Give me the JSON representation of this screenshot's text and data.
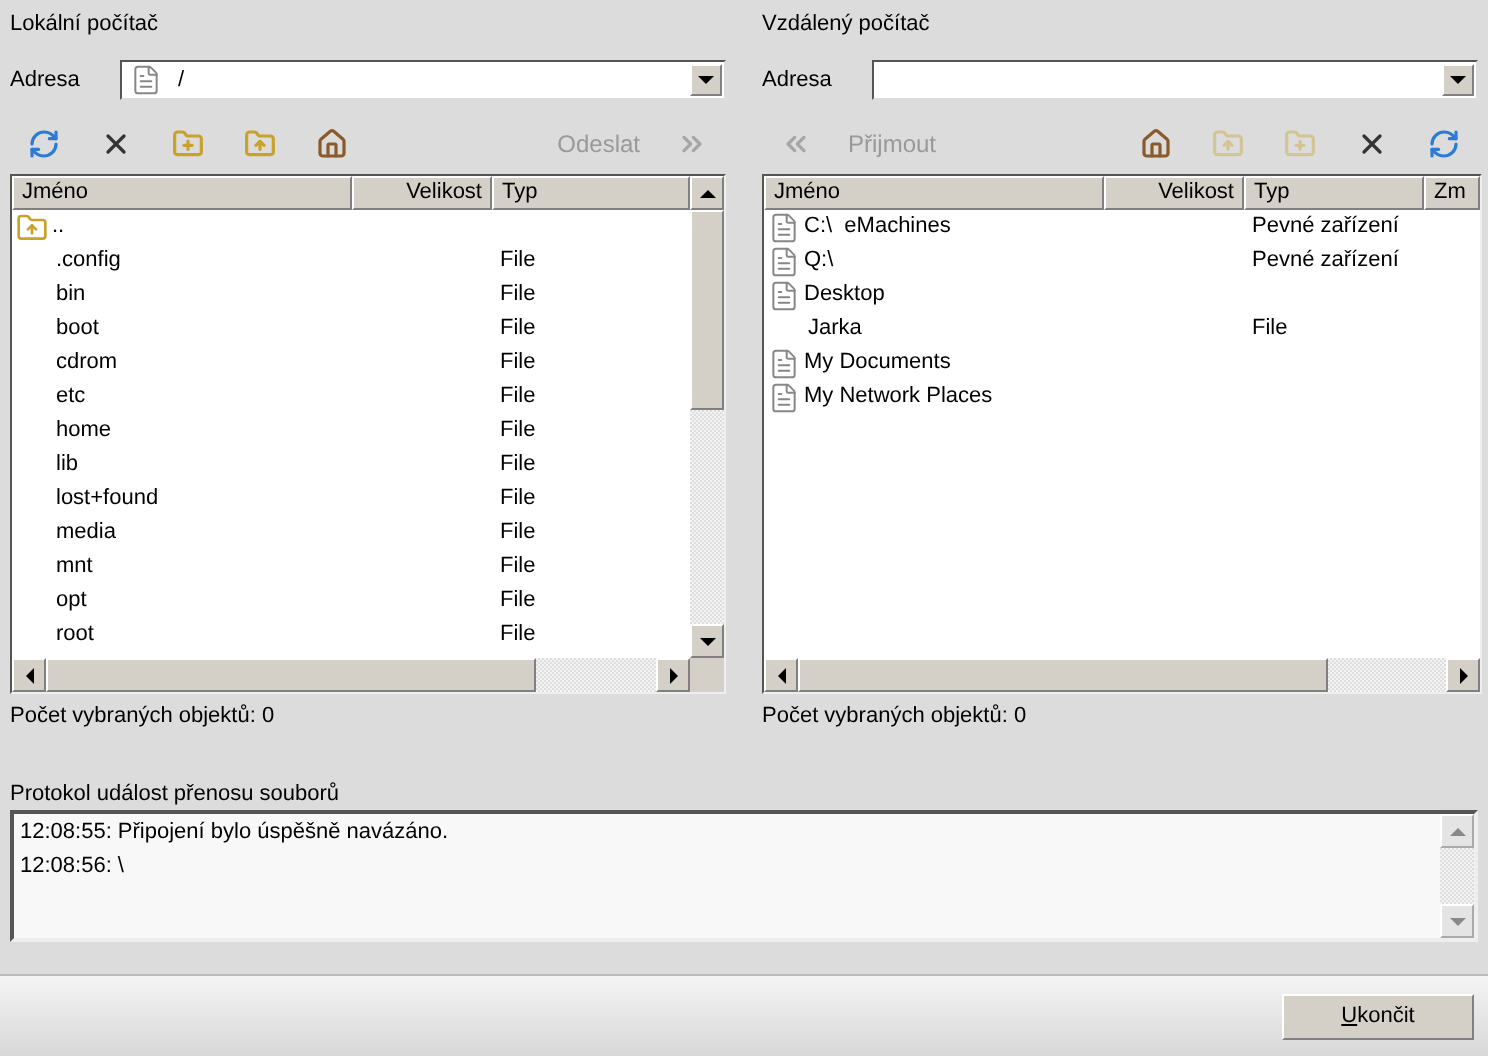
{
  "local": {
    "title": "Lokální počítač",
    "address_label": "Adresa",
    "address": "/",
    "toolbar": [
      {
        "kind": "refresh",
        "disabled": false
      },
      {
        "kind": "delete",
        "disabled": false
      },
      {
        "kind": "new_folder",
        "disabled": false
      },
      {
        "kind": "folder_up",
        "disabled": false
      },
      {
        "kind": "home",
        "disabled": false
      },
      {
        "kind": "spacer"
      },
      {
        "kind": "label",
        "text": "Odeslat",
        "disabled": true
      },
      {
        "kind": "send",
        "disabled": true
      }
    ],
    "columns": [
      "Jméno",
      "Velikost",
      "Typ"
    ],
    "rows": [
      {
        "kind": "folder_up",
        "name": "..",
        "type": ""
      },
      {
        "name": ".config",
        "type": "File"
      },
      {
        "name": "bin",
        "type": "File"
      },
      {
        "name": "boot",
        "type": "File"
      },
      {
        "name": "cdrom",
        "type": "File"
      },
      {
        "name": "etc",
        "type": "File"
      },
      {
        "name": "home",
        "type": "File"
      },
      {
        "name": "lib",
        "type": "File"
      },
      {
        "name": "lost+found",
        "type": "File"
      },
      {
        "name": "media",
        "type": "File"
      },
      {
        "name": "mnt",
        "type": "File"
      },
      {
        "name": "opt",
        "type": "File"
      },
      {
        "name": "root",
        "type": "File"
      }
    ],
    "status": "Počet vybraných objektů: 0"
  },
  "remote": {
    "title": "Vzdálený počítač",
    "address_label": "Adresa",
    "toolbar": [
      {
        "kind": "receive",
        "disabled": true
      },
      {
        "kind": "label",
        "text": "Přijmout",
        "disabled": true
      },
      {
        "kind": "spacer"
      },
      {
        "kind": "home",
        "disabled": false
      },
      {
        "kind": "folder_up",
        "disabled": true
      },
      {
        "kind": "new_folder",
        "disabled": true
      },
      {
        "kind": "delete",
        "disabled": false
      },
      {
        "kind": "refresh",
        "disabled": false
      }
    ],
    "columns": [
      "Jméno",
      "Velikost",
      "Typ",
      "Zm"
    ],
    "rows": [
      {
        "kind": "document",
        "name": "C:\\  eMachines",
        "type": "Pevné zařízení"
      },
      {
        "kind": "document",
        "name": "Q:\\",
        "type": "Pevné zařízení"
      },
      {
        "kind": "document",
        "name": "Desktop",
        "type": ""
      },
      {
        "name": "Jarka",
        "type": "File"
      },
      {
        "kind": "document",
        "name": "My Documents",
        "type": ""
      },
      {
        "kind": "document",
        "name": "My Network Places",
        "type": ""
      }
    ],
    "status": "Počet vybraných objektů: 0"
  },
  "log": {
    "title": "Protokol událost přenosu souborů",
    "lines": [
      "12:08:55: Připojení bylo úspěšně navázáno.",
      "12:08:56: \\"
    ]
  },
  "buttons": [
    "Ukončit"
  ]
}
